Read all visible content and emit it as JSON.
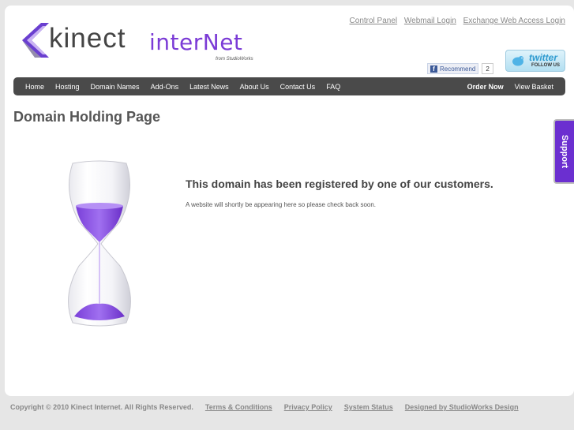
{
  "brand": {
    "kinect": "kinect",
    "internet": "interNet",
    "from": "from StudioWorks",
    "accent": "#7b3bd6"
  },
  "top_links": [
    "Control Panel",
    "Webmail Login",
    "Exchange Web Access Login"
  ],
  "social": {
    "fb_label": "Recommend",
    "fb_count": "2",
    "twitter_name": "twitter",
    "twitter_follow": "FOLLOW US"
  },
  "nav": {
    "left": [
      "Home",
      "Hosting",
      "Domain Names",
      "Add-Ons",
      "Latest News",
      "About Us",
      "Contact Us",
      "FAQ"
    ],
    "order_now": "Order Now",
    "view_basket": "View Basket"
  },
  "main": {
    "title": "Domain Holding Page",
    "heading": "This domain has been registered by one of our customers.",
    "body": "A website will shortly be appearing here so please check back soon."
  },
  "support": "Support",
  "footer": {
    "copyright": "Copyright © 2010 Kinect Internet. All Rights Reserved.",
    "links": [
      "Terms & Conditions",
      "Privacy Policy",
      "System Status",
      "Designed by StudioWorks Design"
    ]
  }
}
